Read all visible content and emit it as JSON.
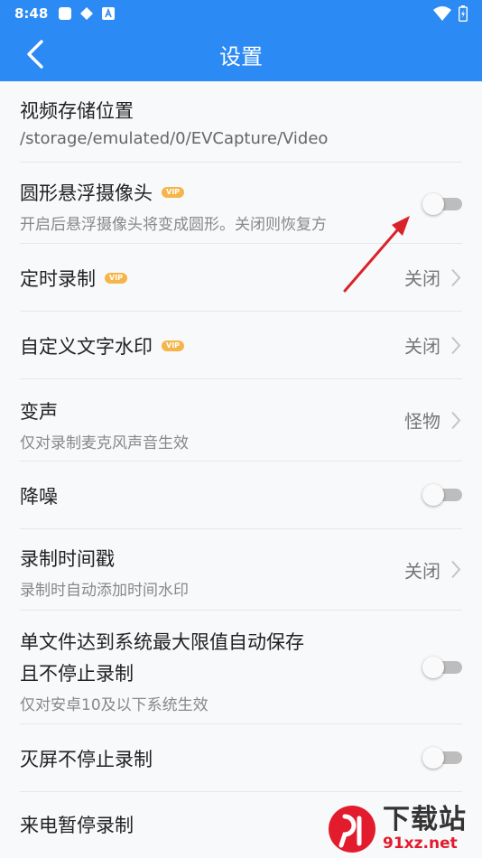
{
  "status_bar": {
    "time": "8:48",
    "icons": [
      "square-icon",
      "pinwheel-icon",
      "a-icon",
      "wifi-icon",
      "battery-icon"
    ]
  },
  "header": {
    "title": "设置"
  },
  "settings": [
    {
      "title": "视频存储位置",
      "subtitle": "/storage/emulated/0/EVCapture/Video"
    },
    {
      "title": "圆形悬浮摄像头",
      "vip": "VIP",
      "subtitle": "开启后悬浮摄像头将变成圆形。关闭则恢复方",
      "toggle": "off"
    },
    {
      "title": "定时录制",
      "vip": "VIP",
      "value": "关闭"
    },
    {
      "title": "自定义文字水印",
      "vip": "VIP",
      "value": "关闭"
    },
    {
      "title": "变声",
      "subtitle": "仅对录制麦克风声音生效",
      "value": "怪物"
    },
    {
      "title": "降噪",
      "toggle": "off"
    },
    {
      "title": "录制时间戳",
      "subtitle": "录制时自动添加时间水印",
      "value": "关闭"
    },
    {
      "title_line1": "单文件达到系统最大限值自动保存",
      "title_line2": "且不停止录制",
      "subtitle": "仅对安卓10及以下系统生效",
      "toggle": "off"
    },
    {
      "title": "灭屏不停止录制",
      "toggle": "off"
    },
    {
      "title": "来电暂停录制"
    }
  ],
  "watermark": {
    "text": "下载站",
    "url": "91xz.net"
  },
  "colors": {
    "primary": "#2b8af3",
    "vip": "#f6b54a",
    "arrow": "#d8232a"
  }
}
